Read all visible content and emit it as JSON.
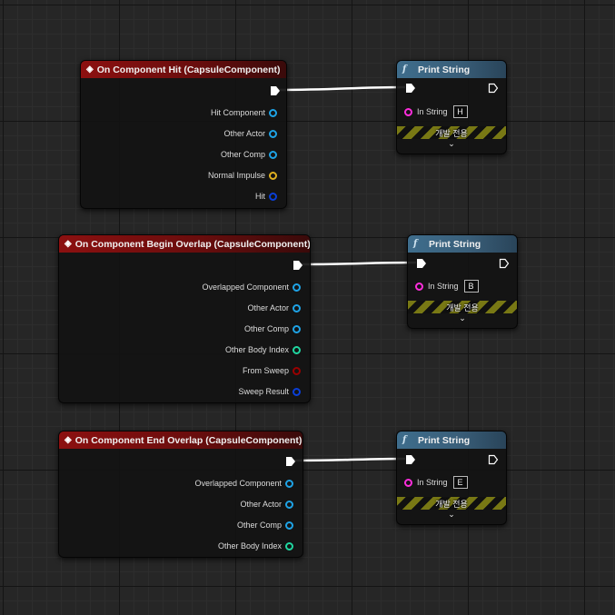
{
  "colors": {
    "event_header": "#8c1010",
    "function_header": "#3e6d8c",
    "object_pin": "#1ea3e6",
    "struct_pin": "#0a3fd8",
    "vector_pin": "#e0b020",
    "int_pin": "#20d6a0",
    "bool_pin": "#9a0000",
    "string_pin": "#ff2ddc",
    "exec_wire": "#ffffff",
    "dev_stripe": "#787814"
  },
  "events": [
    {
      "title": "On Component Hit (CapsuleComponent)",
      "icon": "event-diamond-icon",
      "pins": [
        {
          "label": "Hit Component",
          "type": "object"
        },
        {
          "label": "Other Actor",
          "type": "object"
        },
        {
          "label": "Other Comp",
          "type": "object"
        },
        {
          "label": "Normal Impulse",
          "type": "vector"
        },
        {
          "label": "Hit",
          "type": "struct"
        }
      ]
    },
    {
      "title": "On Component Begin Overlap (CapsuleComponent)",
      "icon": "event-diamond-icon",
      "pins": [
        {
          "label": "Overlapped Component",
          "type": "object"
        },
        {
          "label": "Other Actor",
          "type": "object"
        },
        {
          "label": "Other Comp",
          "type": "object"
        },
        {
          "label": "Other Body Index",
          "type": "int"
        },
        {
          "label": "From Sweep",
          "type": "bool"
        },
        {
          "label": "Sweep Result",
          "type": "struct"
        }
      ]
    },
    {
      "title": "On Component End Overlap (CapsuleComponent)",
      "icon": "event-diamond-icon",
      "pins": [
        {
          "label": "Overlapped Component",
          "type": "object"
        },
        {
          "label": "Other Actor",
          "type": "object"
        },
        {
          "label": "Other Comp",
          "type": "object"
        },
        {
          "label": "Other Body Index",
          "type": "int"
        }
      ]
    }
  ],
  "prints": [
    {
      "title": "Print String",
      "icon": "function-f-icon",
      "pin_label": "In String",
      "value": "H",
      "dev_label": "개발 전용",
      "expand": "expand-chevron-icon"
    },
    {
      "title": "Print String",
      "icon": "function-f-icon",
      "pin_label": "In String",
      "value": "B",
      "dev_label": "개발 전용",
      "expand": "expand-chevron-icon"
    },
    {
      "title": "Print String",
      "icon": "function-f-icon",
      "pin_label": "In String",
      "value": "E",
      "dev_label": "개발 전용",
      "expand": "expand-chevron-icon"
    }
  ]
}
